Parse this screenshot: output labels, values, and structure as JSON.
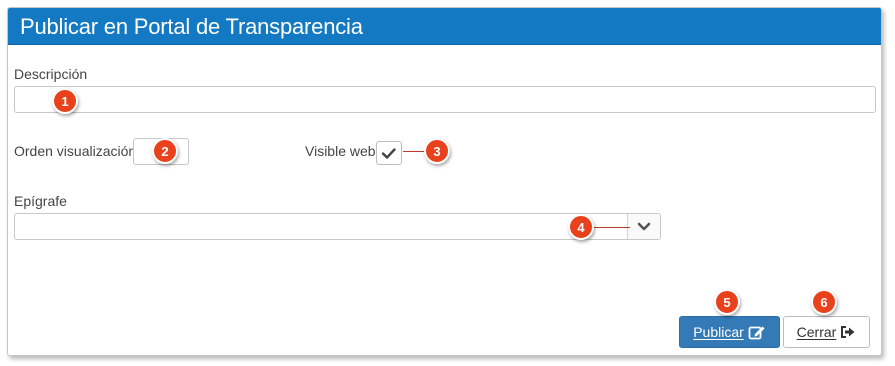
{
  "dialog": {
    "title": "Publicar en Portal de Transparencia"
  },
  "form": {
    "descripcion_label": "Descripción",
    "descripcion_value": "",
    "orden_label": "Orden visualización",
    "orden_value": "",
    "visible_label": "Visible web",
    "visible_checked": true,
    "epigrafe_label": "Epígrafe",
    "epigrafe_value": ""
  },
  "buttons": {
    "publicar": "Publicar",
    "cerrar": "Cerrar"
  },
  "callouts": [
    "1",
    "2",
    "3",
    "4",
    "5",
    "6"
  ],
  "colors": {
    "title_bar": "#1379c3",
    "primary_button": "#337ab7",
    "callout": "#e8411c"
  }
}
